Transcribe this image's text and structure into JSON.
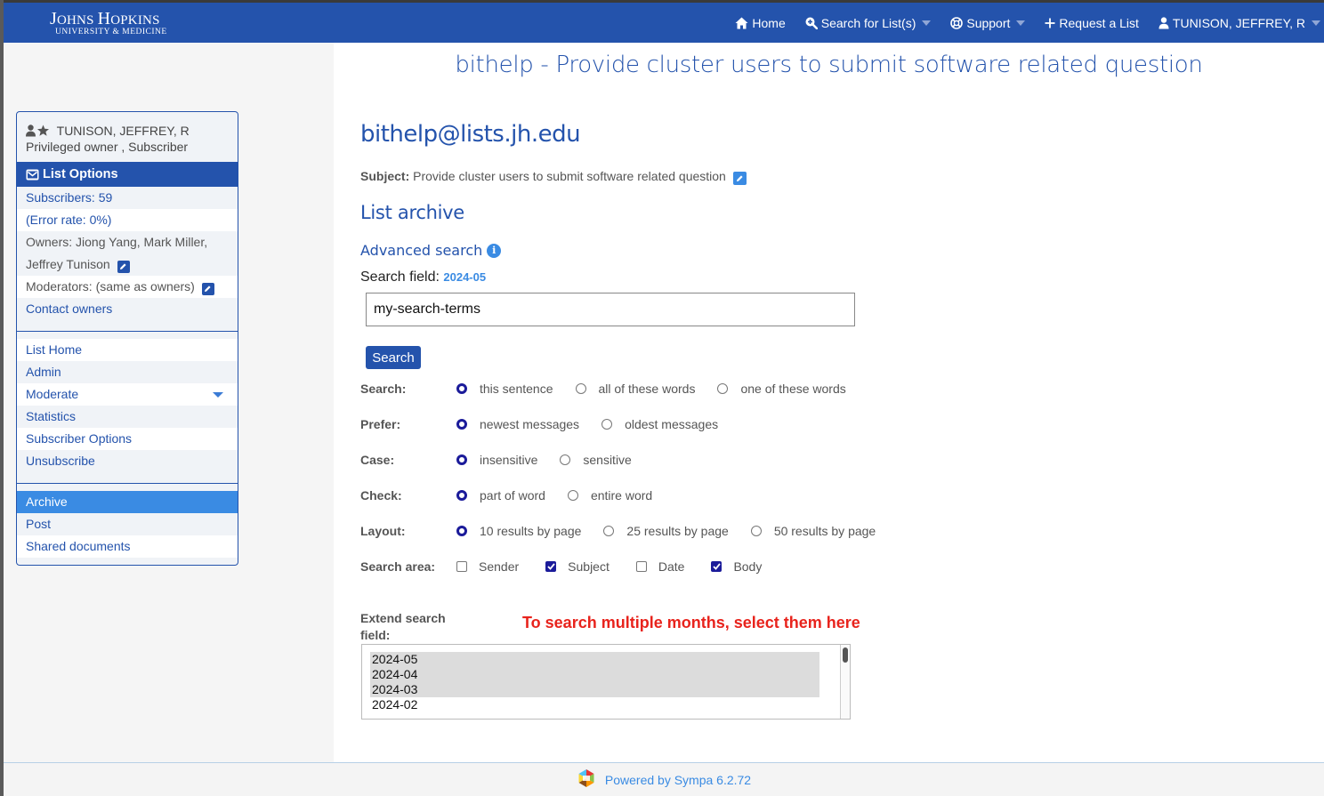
{
  "navbar": {
    "logo_line1": "JOHNS HOPKINS",
    "logo_line1_parts": [
      "J",
      "OHNS ",
      "H",
      "OPKINS"
    ],
    "logo_line2": "UNIVERSITY & MEDICINE",
    "items": [
      {
        "label": "Home",
        "icon": "home-icon",
        "dropdown": false
      },
      {
        "label": "Search for List(s)",
        "icon": "search-plus-icon",
        "dropdown": true
      },
      {
        "label": "Support",
        "icon": "life-ring-icon",
        "dropdown": true
      },
      {
        "label": "Request a List",
        "icon": "plus-icon",
        "dropdown": false
      },
      {
        "label": "TUNISON, JEFFREY, R",
        "icon": "user-icon",
        "dropdown": true
      }
    ]
  },
  "sidebar": {
    "user_name": "TUNISON, JEFFREY, R",
    "user_roles": "Privileged owner , Subscriber",
    "list_options_title": "List Options",
    "info": {
      "subscribers": "Subscribers: 59",
      "error_rate": "(Error rate: 0%)",
      "owners_line1": "Owners: Jiong Yang, Mark Miller,",
      "owners_line2": "Jeffrey Tunison",
      "moderators": "Moderators: (same as owners)",
      "contact_owners": "Contact owners"
    },
    "nav": [
      {
        "label": "List Home"
      },
      {
        "label": "Admin"
      },
      {
        "label": "Moderate"
      },
      {
        "label": "Statistics"
      },
      {
        "label": "Subscriber Options"
      },
      {
        "label": "Unsubscribe"
      }
    ],
    "nav2": [
      {
        "label": "Archive",
        "active": true
      },
      {
        "label": "Post"
      },
      {
        "label": "Shared documents"
      }
    ]
  },
  "main": {
    "page_title": "bithelp - Provide cluster users to submit software related question",
    "list_address": "bithelp@lists.jh.edu",
    "subject_label": "Subject:",
    "subject_value": "Provide cluster users to submit software related question",
    "archive_heading": "List archive",
    "advanced_search": "Advanced search",
    "search_field_label": "Search field:",
    "search_field_value": "2024-05",
    "search_input_value": "my-search-terms",
    "search_button": "Search",
    "options": {
      "search": {
        "label": "Search:",
        "choices": [
          "this sentence",
          "all of these words",
          "one of these words"
        ],
        "selected": "this sentence"
      },
      "prefer": {
        "label": "Prefer:",
        "choices": [
          "newest messages",
          "oldest messages"
        ],
        "selected": "newest messages"
      },
      "case": {
        "label": "Case:",
        "choices": [
          "insensitive",
          "sensitive"
        ],
        "selected": "insensitive"
      },
      "check": {
        "label": "Check:",
        "choices": [
          "part of word",
          "entire word"
        ],
        "selected": "part of word"
      },
      "layout": {
        "label": "Layout:",
        "choices": [
          "10 results by page",
          "25 results by page",
          "50 results by page"
        ],
        "selected": "10 results by page"
      },
      "area": {
        "label": "Search area:",
        "choices": [
          {
            "label": "Sender",
            "checked": false
          },
          {
            "label": "Subject",
            "checked": true
          },
          {
            "label": "Date",
            "checked": false
          },
          {
            "label": "Body",
            "checked": true
          }
        ]
      }
    },
    "extend_label": "Extend search field:",
    "hint": "To search multiple months, select them here",
    "months": [
      {
        "label": "2024-05",
        "selected": true
      },
      {
        "label": "2024-04",
        "selected": true
      },
      {
        "label": "2024-03",
        "selected": true
      },
      {
        "label": "2024-02",
        "selected": false
      }
    ]
  },
  "footer": {
    "text": "Powered by Sympa 6.2.72"
  },
  "colors": {
    "brand": "#2453ac",
    "accent": "#3a8be3",
    "hint": "#e8231c",
    "radio_checked": "#1b1b9a"
  }
}
